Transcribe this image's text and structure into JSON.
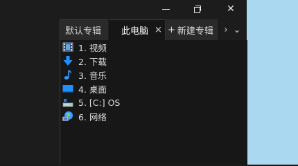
{
  "tabs": [
    {
      "label": "默认专辑"
    },
    {
      "label": "此电脑",
      "close": "×"
    },
    {
      "label": "新建专辑",
      "plus": "+"
    }
  ],
  "tab_arrows": {
    "next": "›",
    "menu": "⌄"
  },
  "window_controls": {
    "close": "✕"
  },
  "items": [
    {
      "label": "1. 视频",
      "icon": "video-icon"
    },
    {
      "label": "2. 下载",
      "icon": "download-icon"
    },
    {
      "label": "3. 音乐",
      "icon": "music-icon"
    },
    {
      "label": "4. 桌面",
      "icon": "desktop-icon"
    },
    {
      "label": "5. [C:] OS",
      "icon": "drive-icon"
    },
    {
      "label": "6. 网络",
      "icon": "network-icon"
    }
  ],
  "colors": {
    "background": "#1a1a1a",
    "desktop": "#a9d8f0",
    "accent_blue": "#1e90ff"
  }
}
